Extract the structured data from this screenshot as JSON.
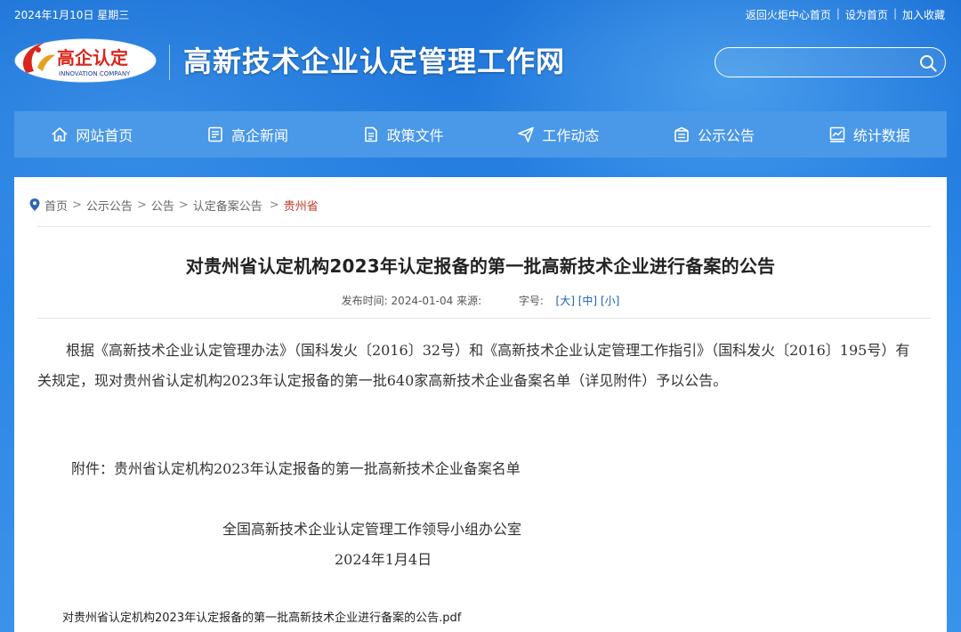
{
  "topbar": {
    "date": "2024年1月10日 星期三",
    "links": [
      "返回火炬中心首页",
      "设为首页",
      "加入收藏"
    ],
    "separator": "|"
  },
  "logo": {
    "text": "高企认定",
    "subtext": "INNOVATION COMPANY"
  },
  "site_title": "高新技术企业认定管理工作网",
  "search": {
    "placeholder": "",
    "icon": "search-icon"
  },
  "nav": [
    {
      "label": "网站首页",
      "icon": "home-icon"
    },
    {
      "label": "高企新闻",
      "icon": "news-icon"
    },
    {
      "label": "政策文件",
      "icon": "document-icon"
    },
    {
      "label": "工作动态",
      "icon": "send-icon"
    },
    {
      "label": "公示公告",
      "icon": "notice-icon"
    },
    {
      "label": "统计数据",
      "icon": "chart-icon"
    }
  ],
  "breadcrumb": {
    "items": [
      "首页",
      "公示公告",
      "公告",
      "认定备案公告"
    ],
    "current": "贵州省",
    "separator": ">"
  },
  "article": {
    "title": "对贵州省认定机构2023年认定报备的第一批高新技术企业进行备案的公告",
    "publish_label": "发布时间:",
    "publish_date": "2024-01-04",
    "source_label": "来源:",
    "fontsize_label": "字号:",
    "fontsize_options": [
      "[大]",
      "[中]",
      "[小]"
    ],
    "body": "根据《高新技术企业认定管理办法》（国科发火〔2016〕32号）和《高新技术企业认定管理工作指引》（国科发火〔2016〕195号）有关规定，现对贵州省认定机构2023年认定报备的第一批640家高新技术企业备案名单（详见附件）予以公告。",
    "attachment_line": "附件：贵州省认定机构2023年认定报备的第一批高新技术企业备案名单",
    "signature_org": "全国高新技术企业认定管理工作领导小组办公室",
    "signature_date": "2024年1月4日",
    "pdf_link": "对贵州省认定机构2023年认定报备的第一批高新技术企业进行备案的公告.pdf"
  },
  "colors": {
    "header_bg": "#1e74d8",
    "nav_bg": "#4a98e8",
    "breadcrumb_current": "#c0392b",
    "logo_red": "#d9261c"
  }
}
